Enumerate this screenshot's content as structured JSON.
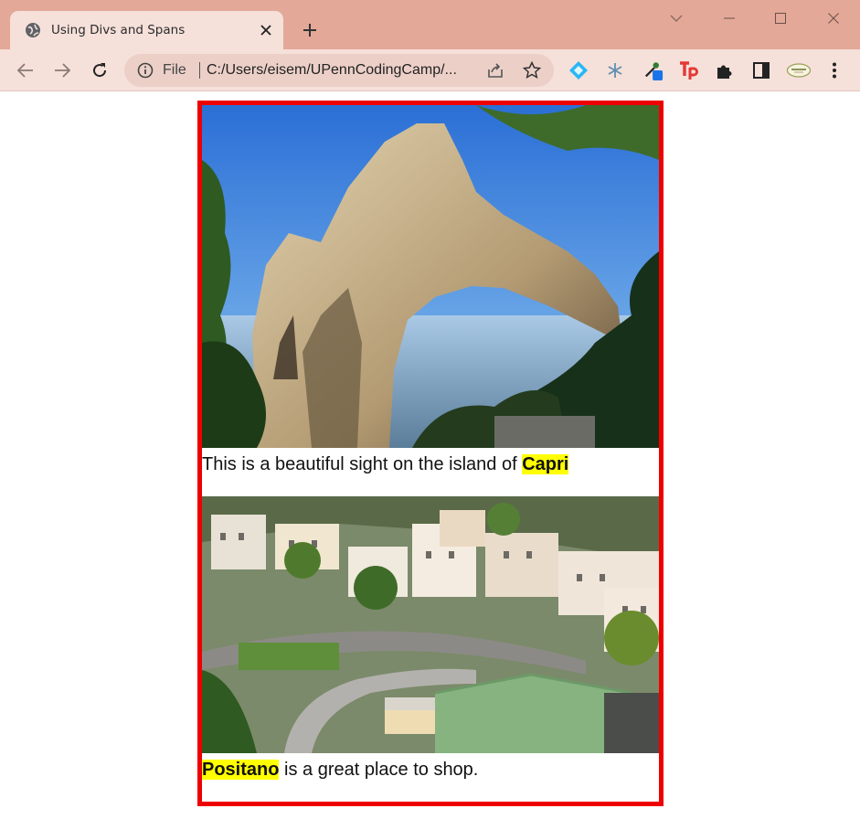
{
  "browser": {
    "tab_title": "Using Divs and Spans",
    "address_scheme_label": "File",
    "address_url": "C:/Users/eisem/UPennCodingCamp/...",
    "icons": {
      "favicon": "globe-icon",
      "close_tab": "close-icon",
      "new_tab": "plus-icon",
      "back": "arrow-left-icon",
      "forward": "arrow-right-icon",
      "reload": "reload-icon",
      "info": "info-icon",
      "share": "share-icon",
      "bookmark": "star-icon",
      "extensions": "puzzle-icon",
      "side_panel": "side-panel-icon",
      "menu": "kebab-menu-icon"
    },
    "colors": {
      "titlebar": "#e3a898",
      "toolbar": "#f5e0da",
      "omnibox": "#ecd0c8"
    }
  },
  "page": {
    "border_color": "#ee0000",
    "highlight_color": "#ffff00",
    "captions": [
      {
        "before": "This is a beautiful sight on the island of ",
        "highlight": "Capri",
        "after": ""
      },
      {
        "before": "",
        "highlight": "Positano",
        "after": " is a great place to shop."
      }
    ]
  }
}
